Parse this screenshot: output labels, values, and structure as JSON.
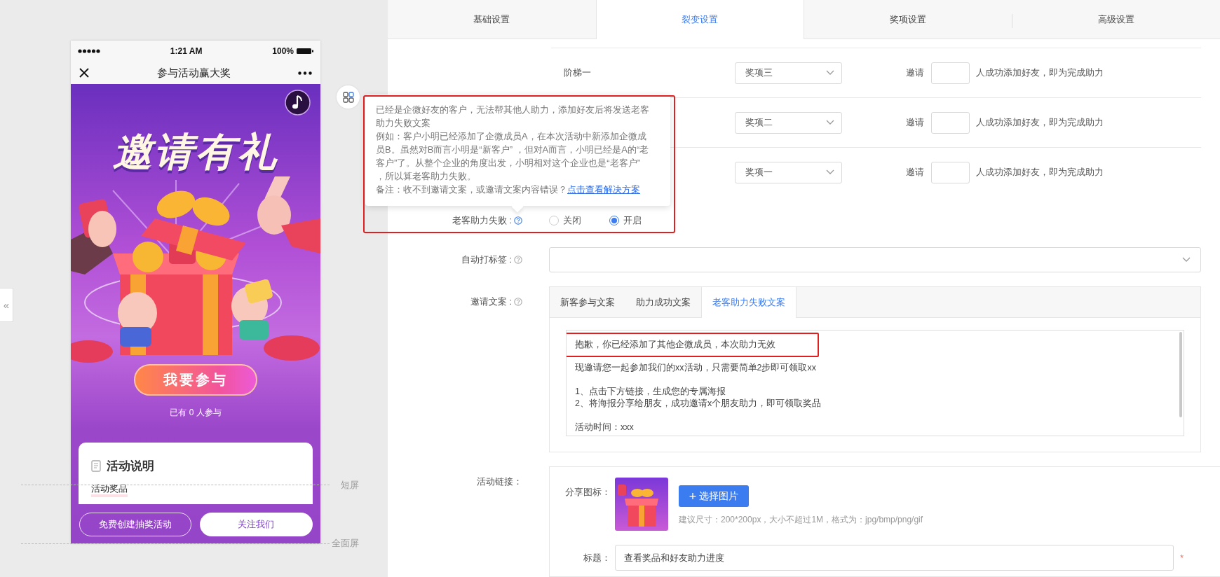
{
  "collapse_tab": "«",
  "preview": {
    "status_bar": {
      "time": "1:21 AM",
      "battery": "100%"
    },
    "nav_title": "参与活动赢大奖",
    "banner_title": "邀请有礼",
    "join_button": "我要参与",
    "participants": "已有 0 人参与",
    "card": {
      "title": "活动说明",
      "section": "活动奖品"
    },
    "bottom_buttons": [
      "免费创建抽奖活动",
      "关注我们"
    ],
    "guides": [
      "短屏",
      "全面屏"
    ]
  },
  "tabs": [
    {
      "label": "基础设置",
      "selected": false
    },
    {
      "label": "裂变设置",
      "selected": true
    },
    {
      "label": "奖项设置",
      "selected": false
    },
    {
      "label": "高级设置",
      "selected": false
    }
  ],
  "ladders": [
    {
      "name": "阶梯一",
      "prize": "奖项三",
      "invite": "邀请",
      "suffix": "人成功添加好友，即为完成助力"
    },
    {
      "prize": "奖项二",
      "invite": "邀请",
      "suffix": "人成功添加好友，即为完成助力"
    },
    {
      "prize": "奖项一",
      "invite": "邀请",
      "suffix": "人成功添加好友，即为完成助力"
    }
  ],
  "tooltip": {
    "paragraphs": [
      "已经是企微好友的客户，无法帮其他人助力，添加好友后将发送老客助力失败文案",
      "例如：客户小明已经添加了企微成员A，在本次活动中新添加企微成员B。虽然对B而言小明是“新客户” ，但对A而言，小明已经是A的“老客户”了。从整个企业的角度出发，小明相对这个企业也是“老客户” ，所以算老客助力失败。"
    ],
    "note": "备注：收不到邀请文案，或邀请文案内容错误？",
    "link": "点击查看解决方案"
  },
  "old_customer_fail": {
    "label": "老客助力失败 :",
    "options": [
      {
        "label": "关闭",
        "selected": false
      },
      {
        "label": "开启",
        "selected": true
      }
    ]
  },
  "auto_tag": {
    "label": "自动打标签 :"
  },
  "invite_copy": {
    "label": "邀请文案 :",
    "tabs": [
      {
        "label": "新客参与文案",
        "selected": false
      },
      {
        "label": "助力成功文案",
        "selected": false
      },
      {
        "label": "老客助力失败文案",
        "selected": true
      }
    ],
    "highlighted_line": "抱歉，你已经添加了其他企微成员，本次助力无效",
    "paragraphs": [
      [
        "现邀请您一起参加我们的xx活动，只需要简单2步即可领取xx"
      ],
      [
        "1、点击下方链接，生成您的专属海报",
        "2、将海报分享给朋友，成功邀请x个朋友助力，即可领取奖品"
      ],
      [
        "活动时间：xxx"
      ]
    ]
  },
  "activity_link": {
    "label": "活动链接：",
    "share_label": "分享图标：",
    "upload_icon": "+",
    "upload_button": "选择图片",
    "hint": "建议尺寸：200*200px，大小不超过1M，格式为：jpg/bmp/png/gif",
    "title_label": "标题：",
    "title_value": "查看奖品和好友助力进度",
    "required": "*"
  }
}
